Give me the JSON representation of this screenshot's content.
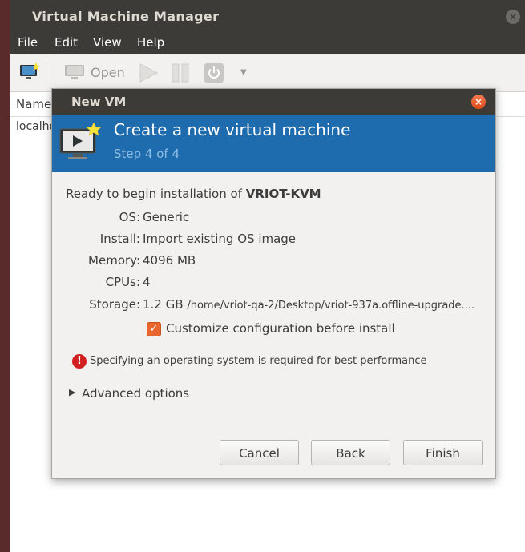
{
  "main_window": {
    "title": "Virtual Machine Manager",
    "close_glyph": "×",
    "menu": [
      "File",
      "Edit",
      "View",
      "Help"
    ],
    "toolbar": {
      "open_label": "Open",
      "icons": [
        "new-vm-icon",
        "monitor-icon",
        "play-icon",
        "pause-icon",
        "power-icon",
        "dropdown-arrow-icon"
      ]
    },
    "list": {
      "column_header": "Name",
      "rows": [
        "localhost (QEMU)"
      ]
    }
  },
  "dialog": {
    "title": "New VM",
    "close_glyph": "×",
    "header": {
      "title": "Create a new virtual machine",
      "step": "Step 4 of 4"
    },
    "ready_prefix": "Ready to begin installation of ",
    "vm_name": "VRIOT-KVM",
    "details": [
      {
        "label": "OS:",
        "value": "Generic"
      },
      {
        "label": "Install:",
        "value": "Import existing OS image"
      },
      {
        "label": "Memory:",
        "value": "4096 MB"
      },
      {
        "label": "CPUs:",
        "value": "4"
      }
    ],
    "storage": {
      "label": "Storage:",
      "size": "1.2 GB",
      "path": "/home/vriot-qa-2/Desktop/vriot-937a.offline-upgrade...."
    },
    "customize": {
      "checked": true,
      "check_glyph": "✓",
      "label": "Customize configuration before install"
    },
    "warning": {
      "glyph": "!",
      "text": "Specifying an operating system is required for best performance"
    },
    "advanced": {
      "arrow": "▶",
      "label": "Advanced options"
    },
    "buttons": {
      "cancel": "Cancel",
      "back": "Back",
      "finish": "Finish"
    }
  },
  "colors": {
    "titlebar": "#3c3b37",
    "header_blue": "#1e6cad",
    "step_text": "#8fbde3",
    "checkbox_orange": "#e9672e",
    "close_orange": "#df4a16",
    "warning_red": "#d21e1e",
    "dialog_bg": "#f2f1f0"
  }
}
